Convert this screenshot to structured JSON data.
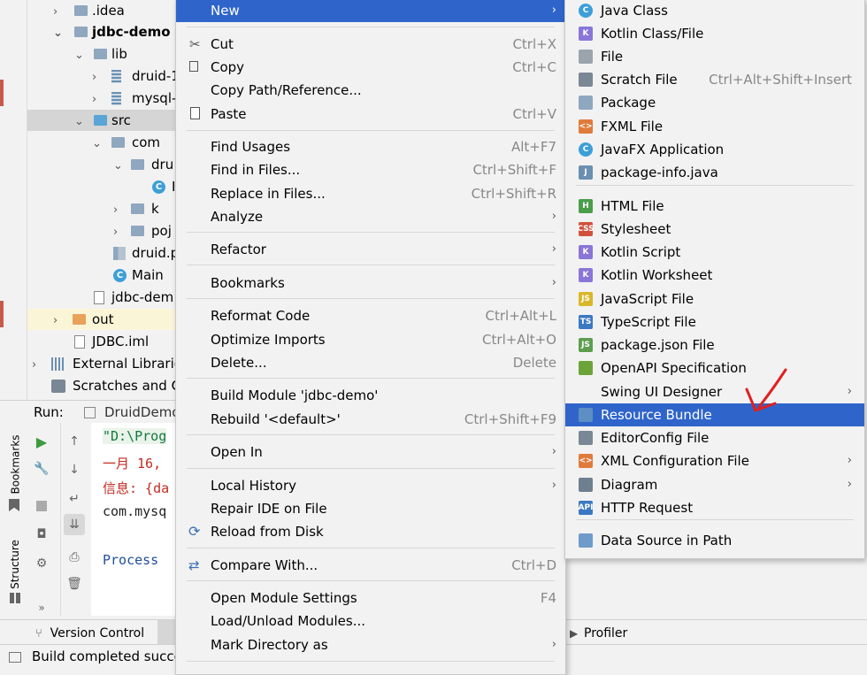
{
  "project_tree": {
    "rows": [
      {
        "label": ".idea"
      },
      {
        "label": "jdbc-demo"
      },
      {
        "label": "lib"
      },
      {
        "label": "druid-1"
      },
      {
        "label": "mysql-"
      },
      {
        "label": "src"
      },
      {
        "label": "com"
      },
      {
        "label": "dru"
      },
      {
        "label": "I"
      },
      {
        "label": "k"
      },
      {
        "label": "poj"
      },
      {
        "label": "druid.p"
      },
      {
        "label": "Main"
      },
      {
        "label": "jdbc-dem"
      },
      {
        "label": "out"
      },
      {
        "label": "JDBC.iml"
      },
      {
        "label": "External Librarie"
      },
      {
        "label": "Scratches and C"
      }
    ]
  },
  "run_panel": {
    "label": "Run:",
    "tab": "DruidDemo",
    "console": [
      "\"D:\\Prog",
      "一月 16,",
      "信息: {da",
      "com.mysq",
      "Process "
    ],
    "side_labels": [
      "Bookmarks",
      "Structure"
    ]
  },
  "bottom_bar": {
    "version_control": "Version Control",
    "profiler": "Profiler",
    "status": "Build completed succe"
  },
  "context_menu": {
    "items": [
      {
        "label": "New",
        "shortcut": "",
        "submenu": true
      },
      {
        "label": "Cut",
        "shortcut": "Ctrl+X"
      },
      {
        "label": "Copy",
        "shortcut": "Ctrl+C"
      },
      {
        "label": "Copy Path/Reference...",
        "shortcut": ""
      },
      {
        "label": "Paste",
        "shortcut": "Ctrl+V"
      },
      {
        "label": "Find Usages",
        "shortcut": "Alt+F7"
      },
      {
        "label": "Find in Files...",
        "shortcut": "Ctrl+Shift+F"
      },
      {
        "label": "Replace in Files...",
        "shortcut": "Ctrl+Shift+R"
      },
      {
        "label": "Analyze",
        "shortcut": "",
        "submenu": true
      },
      {
        "label": "Refactor",
        "shortcut": "",
        "submenu": true
      },
      {
        "label": "Bookmarks",
        "shortcut": "",
        "submenu": true
      },
      {
        "label": "Reformat Code",
        "shortcut": "Ctrl+Alt+L"
      },
      {
        "label": "Optimize Imports",
        "shortcut": "Ctrl+Alt+O"
      },
      {
        "label": "Delete...",
        "shortcut": "Delete"
      },
      {
        "label": "Build Module 'jdbc-demo'",
        "shortcut": ""
      },
      {
        "label": "Rebuild '<default>'",
        "shortcut": "Ctrl+Shift+F9"
      },
      {
        "label": "Open In",
        "shortcut": "",
        "submenu": true
      },
      {
        "label": "Local History",
        "shortcut": "",
        "submenu": true
      },
      {
        "label": "Repair IDE on File",
        "shortcut": ""
      },
      {
        "label": "Reload from Disk",
        "shortcut": ""
      },
      {
        "label": "Compare With...",
        "shortcut": "Ctrl+D"
      },
      {
        "label": "Open Module Settings",
        "shortcut": "F4"
      },
      {
        "label": "Load/Unload Modules...",
        "shortcut": ""
      },
      {
        "label": "Mark Directory as",
        "shortcut": "",
        "submenu": true
      }
    ]
  },
  "new_submenu": {
    "items": [
      {
        "label": "Java Class",
        "shortcut": "",
        "icon": "C",
        "color": "#3d9fd8"
      },
      {
        "label": "Kotlin Class/File",
        "shortcut": "",
        "icon": "K",
        "color": "#8a76d8"
      },
      {
        "label": "File",
        "shortcut": "",
        "icon": "",
        "color": "#9aa4ad"
      },
      {
        "label": "Scratch File",
        "shortcut": "Ctrl+Alt+Shift+Insert",
        "icon": "",
        "color": "#7a8794"
      },
      {
        "label": "Package",
        "shortcut": "",
        "icon": "",
        "color": "#8fa7bf"
      },
      {
        "label": "FXML File",
        "shortcut": "",
        "icon": "<>",
        "color": "#e07b3c"
      },
      {
        "label": "JavaFX Application",
        "shortcut": "",
        "icon": "C",
        "color": "#3d9fd8"
      },
      {
        "label": "package-info.java",
        "shortcut": "",
        "icon": "J",
        "color": "#6b8fb0"
      },
      {
        "label": "HTML File",
        "shortcut": "",
        "icon": "H",
        "color": "#4a9e4a"
      },
      {
        "label": "Stylesheet",
        "shortcut": "",
        "icon": "CSS",
        "color": "#d0523c"
      },
      {
        "label": "Kotlin Script",
        "shortcut": "",
        "icon": "K",
        "color": "#8a76d8"
      },
      {
        "label": "Kotlin Worksheet",
        "shortcut": "",
        "icon": "K",
        "color": "#8a76d8"
      },
      {
        "label": "JavaScript File",
        "shortcut": "",
        "icon": "JS",
        "color": "#d9b72a"
      },
      {
        "label": "TypeScript File",
        "shortcut": "",
        "icon": "TS",
        "color": "#3b78c2"
      },
      {
        "label": "package.json File",
        "shortcut": "",
        "icon": "JS",
        "color": "#5e9e4f"
      },
      {
        "label": "OpenAPI Specification",
        "shortcut": "",
        "icon": "",
        "color": "#6ba539"
      },
      {
        "label": "Swing UI Designer",
        "shortcut": "",
        "icon": "",
        "color": "",
        "submenu": true
      },
      {
        "label": "Resource Bundle",
        "shortcut": "",
        "icon": "",
        "color": "#5d8fc4"
      },
      {
        "label": "EditorConfig File",
        "shortcut": "",
        "icon": "",
        "color": "#7a8794"
      },
      {
        "label": "XML Configuration File",
        "shortcut": "",
        "icon": "<>",
        "color": "#e07b3c",
        "submenu": true
      },
      {
        "label": "Diagram",
        "shortcut": "",
        "icon": "",
        "color": "#6e7f8f",
        "submenu": true
      },
      {
        "label": "HTTP Request",
        "shortcut": "",
        "icon": "API",
        "color": "#3b78c2"
      },
      {
        "label": "Data Source in Path",
        "shortcut": "",
        "icon": "",
        "color": "#6e9bc9"
      }
    ]
  },
  "colors": {
    "selection": "#2f65ca",
    "annotation": "#e02020"
  }
}
